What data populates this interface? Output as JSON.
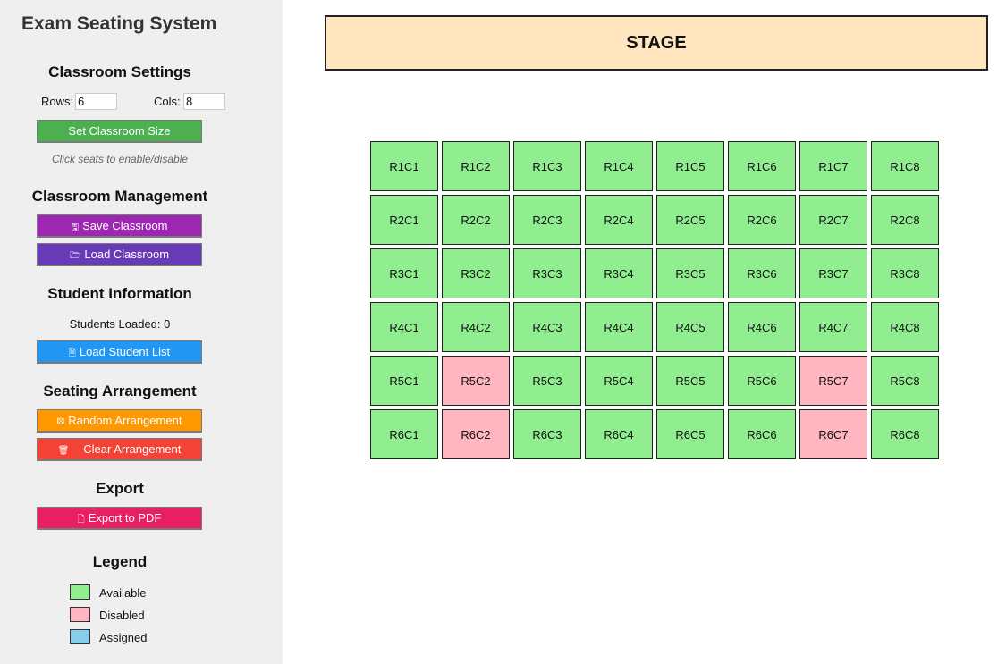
{
  "app": {
    "title": "Exam Seating System"
  },
  "settings": {
    "title": "Classroom Settings",
    "rows_label": "Rows:",
    "rows_value": "6",
    "cols_label": "Cols:",
    "cols_value": "8",
    "set_size_label": "Set Classroom Size",
    "hint": "Click seats to enable/disable"
  },
  "management": {
    "title": "Classroom Management",
    "save_label": "Save Classroom",
    "load_label": "Load Classroom"
  },
  "students": {
    "title": "Student Information",
    "loaded_text": "Students Loaded: 0",
    "load_list_label": "Load Student List"
  },
  "arrangement": {
    "title": "Seating Arrangement",
    "random_label": "Random Arrangement",
    "clear_label": "Clear Arrangement"
  },
  "export": {
    "title": "Export",
    "pdf_label": "Export to PDF"
  },
  "legend": {
    "title": "Legend",
    "items": [
      {
        "label": "Available",
        "color": "#90ee90"
      },
      {
        "label": "Disabled",
        "color": "#ffb6c1"
      },
      {
        "label": "Assigned",
        "color": "#87ceeb"
      }
    ]
  },
  "stage": {
    "label": "STAGE"
  },
  "colors": {
    "available": "#90ee90",
    "disabled": "#ffb6c1",
    "assigned": "#87ceeb",
    "set_size_button": "#4caf50",
    "save_button": "#9c27b0",
    "load_button": "#673ab7",
    "load_students_button": "#2196f3",
    "random_button": "#ff9800",
    "clear_button": "#f44336",
    "export_button": "#e91e63"
  },
  "icons": {
    "save": "floppy-disk-icon",
    "load": "folder-icon",
    "student_list": "clipboard-icon",
    "random": "dice-icon",
    "clear": "trash-icon",
    "export": "document-icon"
  },
  "seats": [
    [
      {
        "label": "R1C1",
        "status": "available"
      },
      {
        "label": "R1C2",
        "status": "available"
      },
      {
        "label": "R1C3",
        "status": "available"
      },
      {
        "label": "R1C4",
        "status": "available"
      },
      {
        "label": "R1C5",
        "status": "available"
      },
      {
        "label": "R1C6",
        "status": "available"
      },
      {
        "label": "R1C7",
        "status": "available"
      },
      {
        "label": "R1C8",
        "status": "available"
      }
    ],
    [
      {
        "label": "R2C1",
        "status": "available"
      },
      {
        "label": "R2C2",
        "status": "available"
      },
      {
        "label": "R2C3",
        "status": "available"
      },
      {
        "label": "R2C4",
        "status": "available"
      },
      {
        "label": "R2C5",
        "status": "available"
      },
      {
        "label": "R2C6",
        "status": "available"
      },
      {
        "label": "R2C7",
        "status": "available"
      },
      {
        "label": "R2C8",
        "status": "available"
      }
    ],
    [
      {
        "label": "R3C1",
        "status": "available"
      },
      {
        "label": "R3C2",
        "status": "available"
      },
      {
        "label": "R3C3",
        "status": "available"
      },
      {
        "label": "R3C4",
        "status": "available"
      },
      {
        "label": "R3C5",
        "status": "available"
      },
      {
        "label": "R3C6",
        "status": "available"
      },
      {
        "label": "R3C7",
        "status": "available"
      },
      {
        "label": "R3C8",
        "status": "available"
      }
    ],
    [
      {
        "label": "R4C1",
        "status": "available"
      },
      {
        "label": "R4C2",
        "status": "available"
      },
      {
        "label": "R4C3",
        "status": "available"
      },
      {
        "label": "R4C4",
        "status": "available"
      },
      {
        "label": "R4C5",
        "status": "available"
      },
      {
        "label": "R4C6",
        "status": "available"
      },
      {
        "label": "R4C7",
        "status": "available"
      },
      {
        "label": "R4C8",
        "status": "available"
      }
    ],
    [
      {
        "label": "R5C1",
        "status": "available"
      },
      {
        "label": "R5C2",
        "status": "disabled"
      },
      {
        "label": "R5C3",
        "status": "available"
      },
      {
        "label": "R5C4",
        "status": "available"
      },
      {
        "label": "R5C5",
        "status": "available"
      },
      {
        "label": "R5C6",
        "status": "available"
      },
      {
        "label": "R5C7",
        "status": "disabled"
      },
      {
        "label": "R5C8",
        "status": "available"
      }
    ],
    [
      {
        "label": "R6C1",
        "status": "available"
      },
      {
        "label": "R6C2",
        "status": "disabled"
      },
      {
        "label": "R6C3",
        "status": "available"
      },
      {
        "label": "R6C4",
        "status": "available"
      },
      {
        "label": "R6C5",
        "status": "available"
      },
      {
        "label": "R6C6",
        "status": "available"
      },
      {
        "label": "R6C7",
        "status": "disabled"
      },
      {
        "label": "R6C8",
        "status": "available"
      }
    ]
  ]
}
